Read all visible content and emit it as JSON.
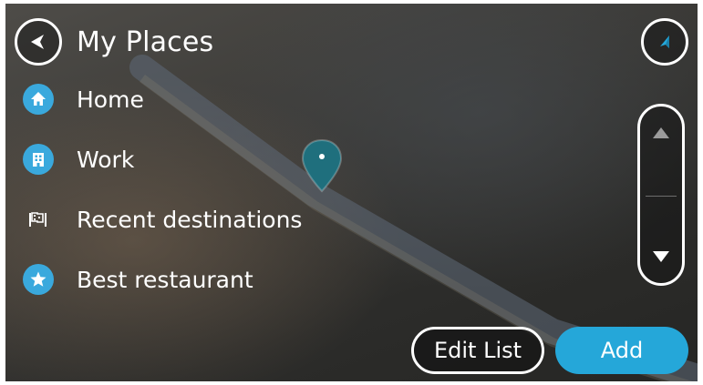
{
  "header": {
    "title": "My Places"
  },
  "list": {
    "items": [
      {
        "label": "Home",
        "icon": "home-icon"
      },
      {
        "label": "Work",
        "icon": "work-icon"
      },
      {
        "label": "Recent destinations",
        "icon": "recent-destinations-flag-icon"
      },
      {
        "label": "Best restaurant",
        "icon": "star-icon"
      }
    ]
  },
  "buttons": {
    "edit_label": "Edit List",
    "add_label": "Add"
  },
  "colors": {
    "accent": "#25a7d9",
    "icon_blue": "#3aa9dd",
    "pin_teal": "#1f6f7d"
  }
}
